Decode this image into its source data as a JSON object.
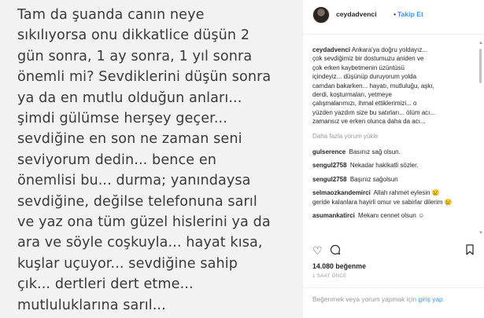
{
  "post": {
    "text": "Tam da şuanda canın neye\nsıkılıyorsa onu dikkatlice düşün 2\ngün sonra, 1 ay sonra, 1 yıl sonra\nönemli mi? Sevdiklerini düşün sonra\nya da en mutlu olduğun anları...\nşimdi gülümse herşey geçer...\nsevdiğine en son ne zaman seni\nseviyorum dedin... bence en\nönemlisi bu... durma; yanındaysa\nsevdiğine, değilse telefonuna sarıl\nve yaz ona tüm güzel hislerini ya da\nara ve söyle coşkuyla... hayat kısa,\nkuşlar uçuyor... sevdiğine sahip\nçık... dertleri dert etme...\nmutluluklarına sarıl..."
  },
  "header": {
    "username": "ceydadvenci",
    "separator": "•",
    "follow_label": "Takip Et"
  },
  "caption": {
    "username": "ceydadvenci",
    "text": " Ankara'ya doğru yoldayız...\nçok sevdiğimiz bir dostumuzu aniden ve\nçok erken kaybetmenin üzüntüsü\niçindeyiz... düşünüp duruyorum yolda\ncamdan bakarken... hayatı, mutluluğu, aşkı,\nderdi, koşturmaları, yetmeye\nçalışmalarımızı, ihmal ettiklerimizi... o\nyüzden yazdım size bu satırları... ölüm acı...\nzamansız ve erken olunca daha da acı..."
  },
  "more_comments_label": "Daha fazla yorum yükle",
  "comments": [
    {
      "username": "gulserence",
      "text": "Basınız sağ olsun."
    },
    {
      "username": "sengul2758",
      "text": "Nekadar hakikatli sözler."
    },
    {
      "username": "sengul2758",
      "text": "Başınız sağolsun"
    },
    {
      "username": "selmaozkandemirci",
      "text": "Allah rahmet eylesin 😢 geride kalanlara hayirli omur ve sabirlar dilerim 😢"
    },
    {
      "username": "asumankatirci",
      "text": "Mekanı cennet olsun ☺"
    }
  ],
  "likes": "14.080 beğenme",
  "time": "1 SAAT ÖNCE",
  "footer": {
    "prefix": "Beğenmek veya yorum yapmak için ",
    "link": "giriş yap",
    "suffix": "."
  },
  "icons": [
    "heart-icon",
    "comment-icon",
    "bookmark-icon"
  ],
  "colors": {
    "accent": "#3897f0",
    "muted": "#999999",
    "text": "#262626"
  }
}
